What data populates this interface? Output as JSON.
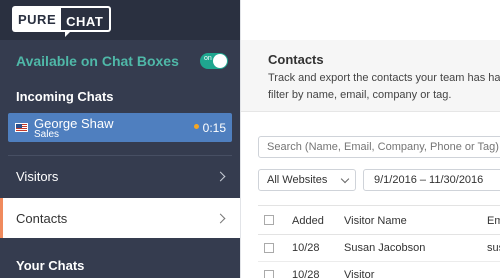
{
  "logo": {
    "part1": "PURE",
    "part2": "CHAT"
  },
  "availability": {
    "label": "Available on Chat Boxes",
    "toggle_text": "on"
  },
  "incoming": {
    "title": "Incoming Chats",
    "chat": {
      "name": "George Shaw",
      "department": "Sales",
      "time": "0:15"
    }
  },
  "nav": [
    {
      "label": "Visitors"
    },
    {
      "label": "Contacts"
    }
  ],
  "your_chats": {
    "title": "Your Chats"
  },
  "page": {
    "title": "Contacts",
    "description_line1": "Track and export the contacts your team has had ch",
    "description_line2": "filter by name, email, company or tag."
  },
  "search": {
    "placeholder": "Search (Name, Email, Company, Phone or Tag)"
  },
  "filters": {
    "website": "All Websites",
    "date_range": "9/1/2016 – 11/30/2016"
  },
  "table": {
    "headers": {
      "added": "Added",
      "name": "Visitor Name",
      "email": "Em"
    },
    "rows": [
      {
        "added": "10/28",
        "name": "Susan Jacobson",
        "email": "sus"
      },
      {
        "added": "10/28",
        "name": "Visitor",
        "email": ""
      }
    ]
  },
  "colors": {
    "sidebar_bg": "#353c4f",
    "accent_teal": "#4fb8a8",
    "active_chat_bg": "#4f7fbf",
    "active_nav_marker": "#f08a5d"
  }
}
